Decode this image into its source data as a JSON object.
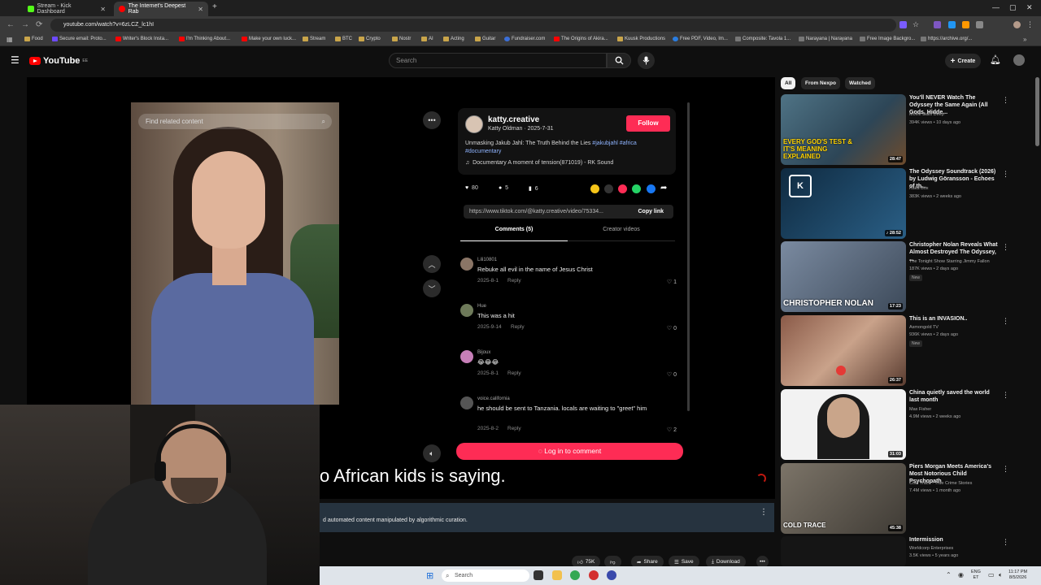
{
  "browser": {
    "tabs": [
      {
        "label": "Stream - Kick Dashboard",
        "color": "#53fc18"
      },
      {
        "label": "The Internet's Deepest Rab",
        "color": "#ff0000"
      }
    ],
    "new_tab": "+",
    "url": "youtube.com/watch?v=6zLCZ_lc1hI",
    "bookmarks": [
      "Food",
      "Secure email: Proto...",
      "Writer's Block Insta...",
      "I'm Thinking About...",
      "Make your own luck...",
      "Stream",
      "BTC",
      "Crypto",
      "Nostr",
      "AI",
      "Acting",
      "Guitar",
      "Fundraiser.com",
      "The Origins of Akira...",
      "Kuusk Productions",
      "Free PDF, Video, Im...",
      "Composite: Tavola 1...",
      "Narayana | Narayana",
      "Free Image Backgro...",
      "https://archive.org/..."
    ]
  },
  "youtube": {
    "logo": "YouTube",
    "region": "EE",
    "search_placeholder": "Search",
    "create_label": "Create"
  },
  "tiktok": {
    "find_placeholder": "Find related content",
    "username": "katty.creative",
    "display_and_date": "Katty Oldman · 2025-7-31",
    "follow_label": "Follow",
    "description": "Unmasking Jakub Jahl: The Truth Behind the Lies ",
    "hashtags": "#jakubjahl #africa #documentary",
    "sound": "Documentary A moment of tension(871019) - RK Sound",
    "likes": "80",
    "comments_count": "5",
    "saves": "6",
    "link": "https://www.tiktok.com/@katty.creative/video/75334...",
    "copy_label": "Copy link",
    "tab_comments": "Comments (5)",
    "tab_creator": "Creator videos",
    "comments": [
      {
        "user": "Lili10801",
        "text": "Rebuke all evil in the name of Jesus Christ",
        "date": "2025-8-1",
        "reply": "Reply",
        "likes": "1"
      },
      {
        "user": "Hue",
        "text": "This was a hit",
        "date": "2025-9-14",
        "reply": "Reply",
        "likes": "0"
      },
      {
        "user": "Bijoux",
        "text": "😂😂😂",
        "date": "2025-8-1",
        "reply": "Reply",
        "likes": "0"
      },
      {
        "user": "voice.california",
        "text": "he should be sent to Tanzania. locals are waiting to \"greet\" him",
        "date": "2025-8-2",
        "reply": "Reply",
        "likes": "2"
      }
    ],
    "login_label": "Log in to comment"
  },
  "video": {
    "caption": "o African kids is saying.",
    "notice": "d automated content manipulated by algorithmic curation."
  },
  "actions": {
    "like_count": "75K",
    "share": "Share",
    "save": "Save",
    "download": "Download"
  },
  "sidebar": {
    "chips": [
      "All",
      "From Nexpo",
      "Watched"
    ],
    "videos": [
      {
        "title": "You'll NEVER Watch The Odyssey the Same Again (All Gods, Hidde...",
        "channel": "Movie Balls Deep",
        "meta": "394K views • 10 days ago",
        "duration": "28:47",
        "overlay": "EVERY GOD'S TEST & IT'S MEANING EXPLAINED",
        "bg": "#3d5a6e",
        "badge": ""
      },
      {
        "title": "The Odyssey Soundtrack (2026) by Ludwig Göransson - Echoes of th...",
        "channel": "Kaka Box",
        "meta": "383K views • 2 weeks ago",
        "duration": "28:52",
        "overlay": "",
        "bg": "#1b3a55",
        "badge": ""
      },
      {
        "title": "Christopher Nolan Reveals What Almost Destroyed The Odyssey, ...",
        "channel": "The Tonight Show Starring Jimmy Fallon",
        "meta": "187K views • 2 days ago",
        "duration": "17:23",
        "overlay": "CHRISTOPHER NOLAN",
        "bg": "#5a6a7a",
        "badge": "New"
      },
      {
        "title": "This is an INVASION..",
        "channel": "Asmongold TV",
        "meta": "936K views • 2 days ago",
        "duration": "26:37",
        "overlay": "",
        "bg": "#7a5040",
        "badge": "New"
      },
      {
        "title": "China quietly saved the world last month",
        "channel": "Max Fisher",
        "meta": "4.9M views • 2 weeks ago",
        "duration": "31:03",
        "overlay": "",
        "bg": "#2a2a2a",
        "badge": ""
      },
      {
        "title": "Piers Morgan Meets America's Most Notorious Child Psychopath",
        "channel": "Cold Trace - True Crime Stories",
        "meta": "7.4M views • 1 month ago",
        "duration": "45:38",
        "overlay": "COLD TRACE",
        "bg": "#6a6258",
        "badge": ""
      },
      {
        "title": "Intermission",
        "channel": "Worldcorp Enterprises",
        "meta": "3.5K views • 5 years ago",
        "duration": "",
        "overlay": "",
        "bg": "#151515",
        "badge": ""
      }
    ]
  },
  "taskbar": {
    "search_label": "Search",
    "lang": "ENG",
    "lang2": "ET",
    "time": "11:17 PM",
    "date": "8/5/2026"
  }
}
